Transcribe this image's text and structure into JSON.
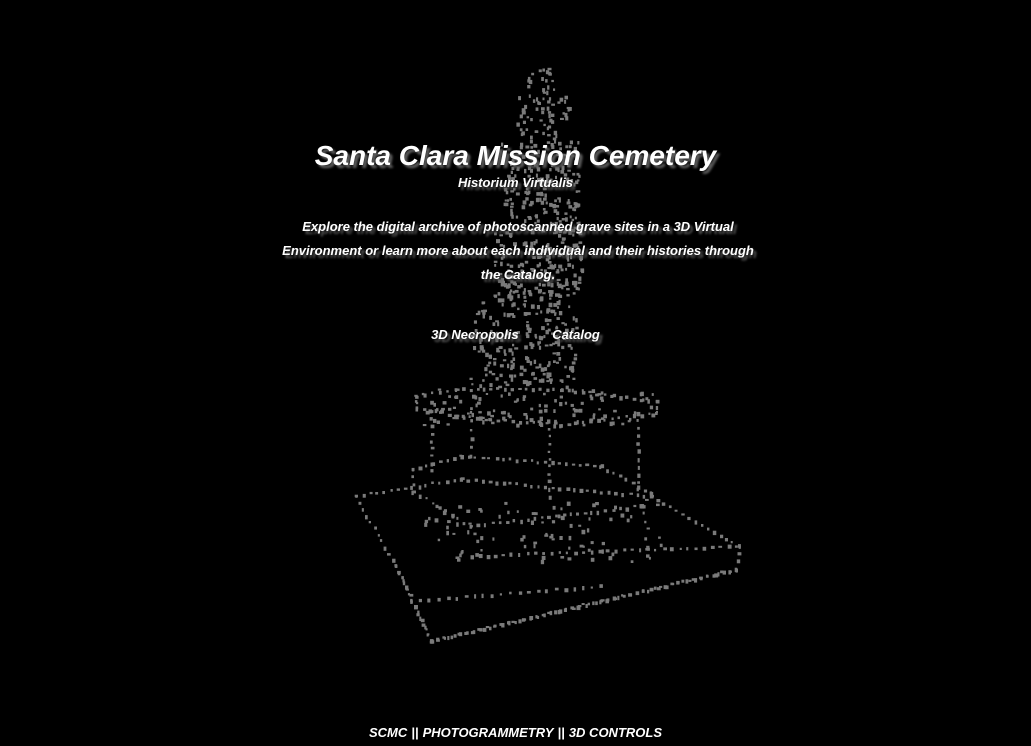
{
  "header": {
    "title": "Santa Clara Mission Cemetery",
    "subtitle": "Historium Virtualis"
  },
  "intro": {
    "text": "Explore the digital archive of photoscanned grave sites in a 3D Virtual Environment or learn more about each individual and their histories through the Catalog."
  },
  "nav": {
    "necropolis_label": "3D Necropolis",
    "catalog_label": "Catalog"
  },
  "footer": {
    "scmc_label": "SCMC",
    "photogrammetry_label": "PHOTOGRAMMETRY",
    "controls_label": "3D CONTROLS",
    "separator": "||"
  },
  "colors": {
    "background": "#000000",
    "text": "#ffffff",
    "point_cloud": "#7a7a7a",
    "shadow": "#5a5a5a"
  }
}
